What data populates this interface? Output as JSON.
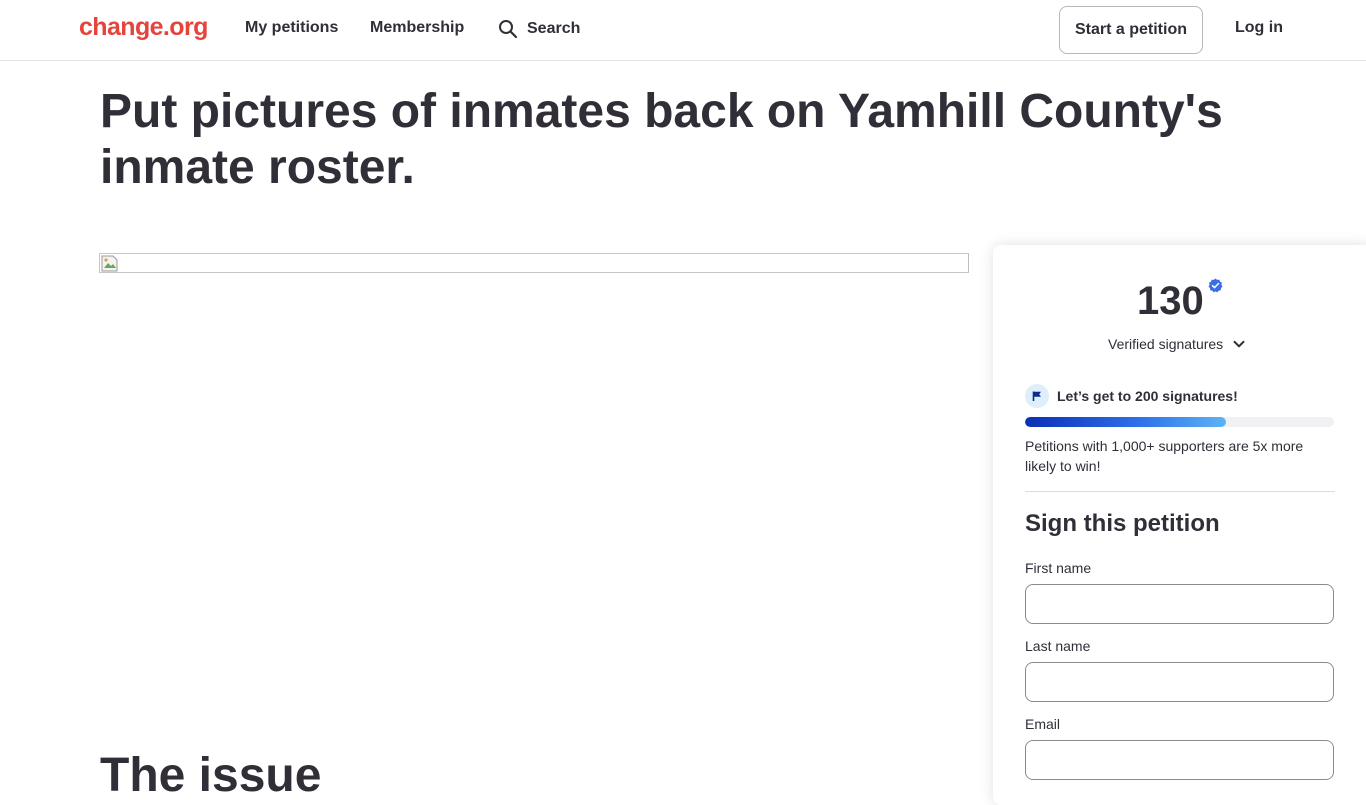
{
  "header": {
    "logo": "change.org",
    "nav": {
      "my_petitions": "My petitions",
      "membership": "Membership",
      "search": "Search"
    },
    "start_petition": "Start a petition",
    "log_in": "Log in"
  },
  "petition": {
    "title": "Put pictures of inmates back on Yamhill County's inmate roster.",
    "issue_heading": "The issue"
  },
  "sign_panel": {
    "signature_count": "130",
    "verified_label": "Verified signatures",
    "goal_text": "Let’s get to 200 signatures!",
    "goal_progress": 0.65,
    "supporters_note": "Petitions with 1,000+ supporters are 5x more likely to win!",
    "heading": "Sign this petition",
    "fields": {
      "first_name_label": "First name",
      "last_name_label": "Last name",
      "email_label": "Email"
    }
  },
  "colors": {
    "brand_red": "#e5443d",
    "text": "#312e38",
    "verified_blue": "#3b6de5",
    "progress_start": "#0a2fb5",
    "progress_end": "#5db4f5"
  },
  "icons": {
    "search": "search-icon",
    "verified": "verified-check-icon",
    "chevron": "chevron-down-icon",
    "flag": "flag-icon",
    "broken_image": "broken-image-icon"
  }
}
